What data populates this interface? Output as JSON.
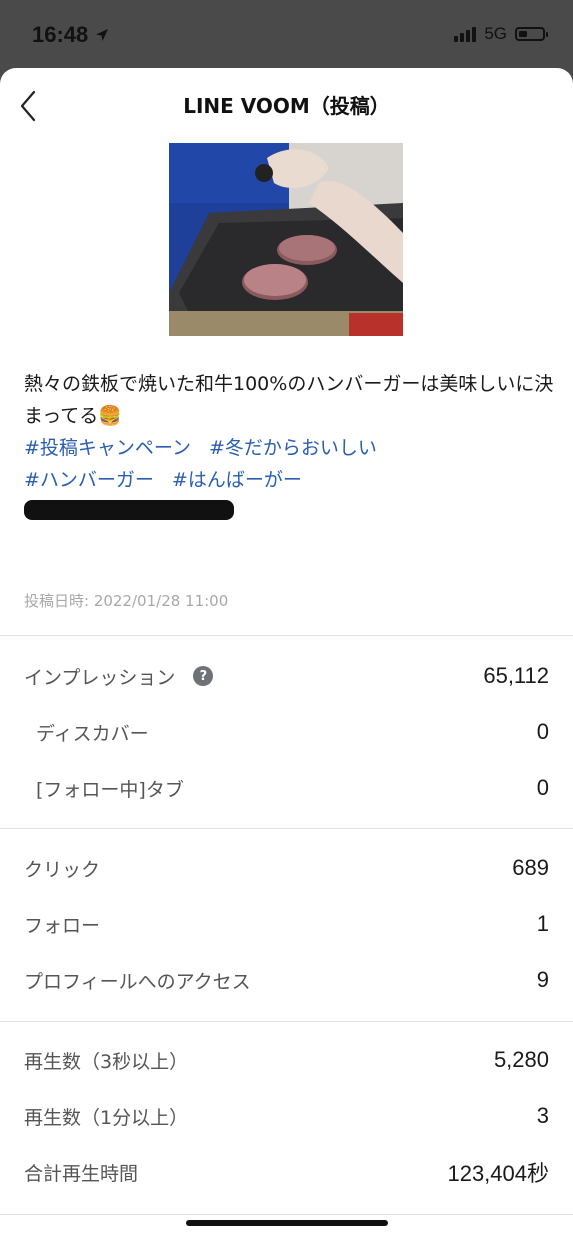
{
  "status_bar": {
    "time": "16:48",
    "network": "5G"
  },
  "header": {
    "title": "LINE VOOM（投稿）"
  },
  "post": {
    "caption": "熱々の鉄板で焼いた和牛100%のハンバーガーは美味しいに決まってる🍔",
    "hashtags": [
      "#投稿キャンペーン",
      "#冬だからおいしい",
      "#ハンバーガー",
      "#はんばーがー"
    ],
    "posted_at": "投稿日時: 2022/01/28 11:00"
  },
  "metrics": {
    "impressions": {
      "label": "インプレッション",
      "help": "?",
      "value": "65,112"
    },
    "discover": {
      "label": "ディスカバー",
      "value": "0"
    },
    "following_tab": {
      "label": "[フォロー中]タブ",
      "value": "0"
    },
    "clicks": {
      "label": "クリック",
      "value": "689"
    },
    "follows": {
      "label": "フォロー",
      "value": "1"
    },
    "profile_access": {
      "label": "プロフィールへのアクセス",
      "value": "9"
    },
    "plays_3s": {
      "label": "再生数（3秒以上）",
      "value": "5,280"
    },
    "plays_1m": {
      "label": "再生数（1分以上）",
      "value": "3"
    },
    "total_play_time": {
      "label": "合計再生時間",
      "value": "123,404秒"
    }
  },
  "colors": {
    "hashtag": "#2a5fb0",
    "muted": "#a8a8a8"
  }
}
